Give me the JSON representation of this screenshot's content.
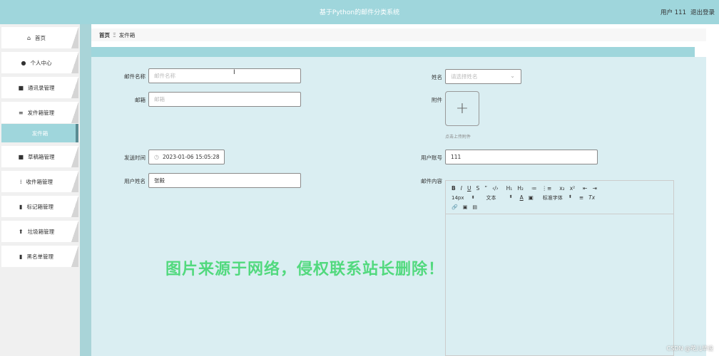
{
  "header": {
    "title": "基于Python的邮件分类系统",
    "user_label": "用户 111",
    "logout": "退出登录"
  },
  "sidebar": {
    "items": [
      {
        "label": "首页",
        "icon": "home-icon",
        "glyph": "⌂"
      },
      {
        "label": "个人中心",
        "icon": "user-icon",
        "glyph": "●"
      },
      {
        "label": "通讯录管理",
        "icon": "grid-icon",
        "glyph": "■"
      },
      {
        "label": "发件箱管理",
        "icon": "list-icon",
        "glyph": "≡"
      },
      {
        "label": "草稿箱管理",
        "icon": "grid-icon",
        "glyph": "■"
      },
      {
        "label": "收件箱管理",
        "icon": "apps-icon",
        "glyph": "⁞"
      },
      {
        "label": "标记箱管理",
        "icon": "bar-chart-icon",
        "glyph": "▮"
      },
      {
        "label": "垃圾箱管理",
        "icon": "upload-icon",
        "glyph": "⬆"
      },
      {
        "label": "黑名单管理",
        "icon": "stats-icon",
        "glyph": "▮"
      }
    ],
    "active_sub": "发件箱"
  },
  "breadcrumb": {
    "home": "首页",
    "sep": "Ξ",
    "current": "发件箱"
  },
  "form": {
    "mail_name": {
      "label": "邮件名称",
      "placeholder": "邮件名称"
    },
    "email": {
      "label": "邮箱",
      "placeholder": "邮箱"
    },
    "send_time": {
      "label": "发送时间",
      "value": "2023-01-06 15:05:28"
    },
    "user_name": {
      "label": "用户姓名",
      "value": "张毅"
    },
    "name": {
      "label": "姓名",
      "placeholder": "请选择姓名"
    },
    "attachment": {
      "label": "附件",
      "tip": "点击上传附件"
    },
    "user_account": {
      "label": "用户账号",
      "value": "111"
    },
    "mail_content": {
      "label": "邮件内容"
    }
  },
  "editor": {
    "row1": [
      "B",
      "I",
      "U",
      "S",
      "”",
      "‹/›",
      "H₁",
      "H₂",
      "≔",
      "⋮≡",
      "x₂",
      "x²",
      "⇤",
      "⇥"
    ],
    "font_size": "14px",
    "text_style": "文本",
    "font_color_icon": "A",
    "bg_color_icon": "▣",
    "font_family": "标准字体",
    "align_icon": "≡",
    "clear_icon": "Tx",
    "row3": [
      "🔗",
      "▣",
      "▤"
    ]
  },
  "watermark": "图片来源于网络，侵权联系站长删除！",
  "csdn_mark": "CSDN @花儿毕设",
  "colors": {
    "header_bg": "#9fd6dc",
    "panel_bg": "#daeef2",
    "watermark": "#3bd66a"
  }
}
